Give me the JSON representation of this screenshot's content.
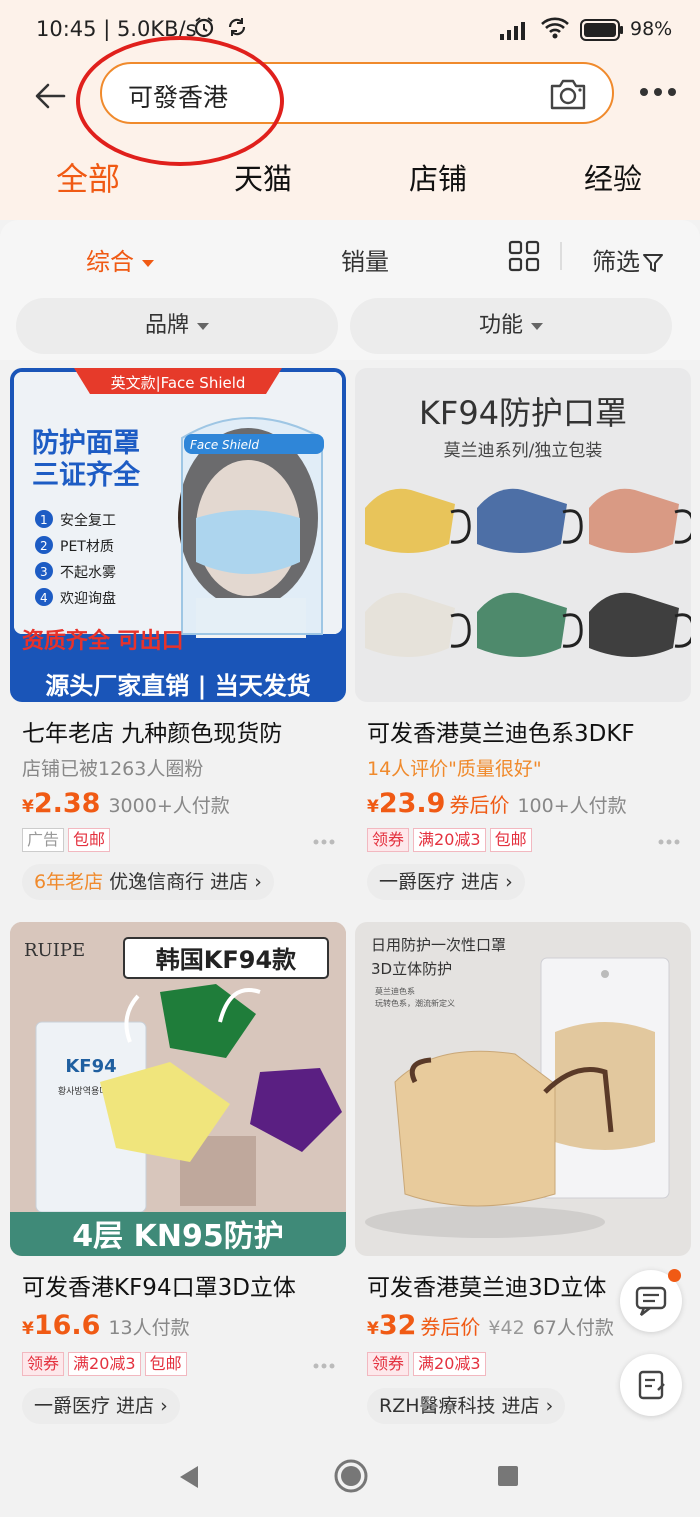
{
  "status": {
    "time": "10:45 | 5.0KB/s",
    "battery": "98%"
  },
  "search": {
    "query": "可發香港"
  },
  "tabs": [
    {
      "label": "全部",
      "active": true
    },
    {
      "label": "天猫"
    },
    {
      "label": "店铺"
    },
    {
      "label": "经验"
    }
  ],
  "sort": {
    "comprehensive": "综合",
    "sales": "销量",
    "filter": "筛选"
  },
  "filters": {
    "brand": "品牌",
    "function": "功能"
  },
  "products": [
    {
      "image": {
        "banner": "英文款|Face Shield",
        "headline1": "防护面罩",
        "headline2": "三证齐全",
        "features": [
          "安全复工",
          "PET材质",
          "不起水雾",
          "欢迎询盘"
        ],
        "red_text": "资质齐全 可出口",
        "bottom": "源头厂家直销 | 当天发货",
        "visor_label": "Face Shield"
      },
      "title": "七年老店 九种颜色现货防",
      "subtitle": "店铺已被1263人圈粉",
      "currency": "¥",
      "price": "2.38",
      "paid": "3000+人付款",
      "tags": [
        "广告",
        "包邮"
      ],
      "shop_age": "6年老店",
      "shop": "优逸信商行 进店"
    },
    {
      "image": {
        "headline": "KF94防护口罩",
        "subline": "莫兰迪系列/独立包装",
        "mask_colors": [
          "#e8c45a",
          "#4d6fa6",
          "#d99a84",
          "#e6e2da",
          "#4e8a6c",
          "#3f3f3f"
        ]
      },
      "title": "可发香港莫兰迪色系3DKF",
      "subtitle": "14人评价\"质量很好\"",
      "currency": "¥",
      "price": "23.9",
      "after_coupon": "券后价",
      "paid": "100+人付款",
      "tags": [
        "领券",
        "满20减3",
        "包邮"
      ],
      "shop": "一爵医疗 进店"
    },
    {
      "image": {
        "brand": "RUIPE",
        "headline": "韩国KF94款",
        "pack_text": "KF94",
        "pack_korean": "황사방역용마스크",
        "bottom": "4层 KN95防护"
      },
      "title": "可发香港KF94口罩3D立体",
      "currency": "¥",
      "price": "16.6",
      "paid": "13人付款",
      "tags": [
        "领券",
        "满20减3",
        "包邮"
      ],
      "shop": "一爵医疗 进店"
    },
    {
      "image": {
        "headline": "日用防护一次性口罩",
        "subline": "3D立体防护",
        "small1": "莫兰迪色系",
        "small2": "玩转色系，潮流新定义"
      },
      "title": "可发香港莫兰迪3D立体",
      "currency": "¥",
      "price": "32",
      "after_coupon": "券后价",
      "orig": "¥42",
      "paid": "67人付款",
      "tags": [
        "领券",
        "满20减3"
      ],
      "shop": "RZH醫療科技 进店"
    }
  ],
  "colors": {
    "accent": "#f05a14",
    "search_border": "#f08a2c",
    "annotation": "#e0201c"
  }
}
